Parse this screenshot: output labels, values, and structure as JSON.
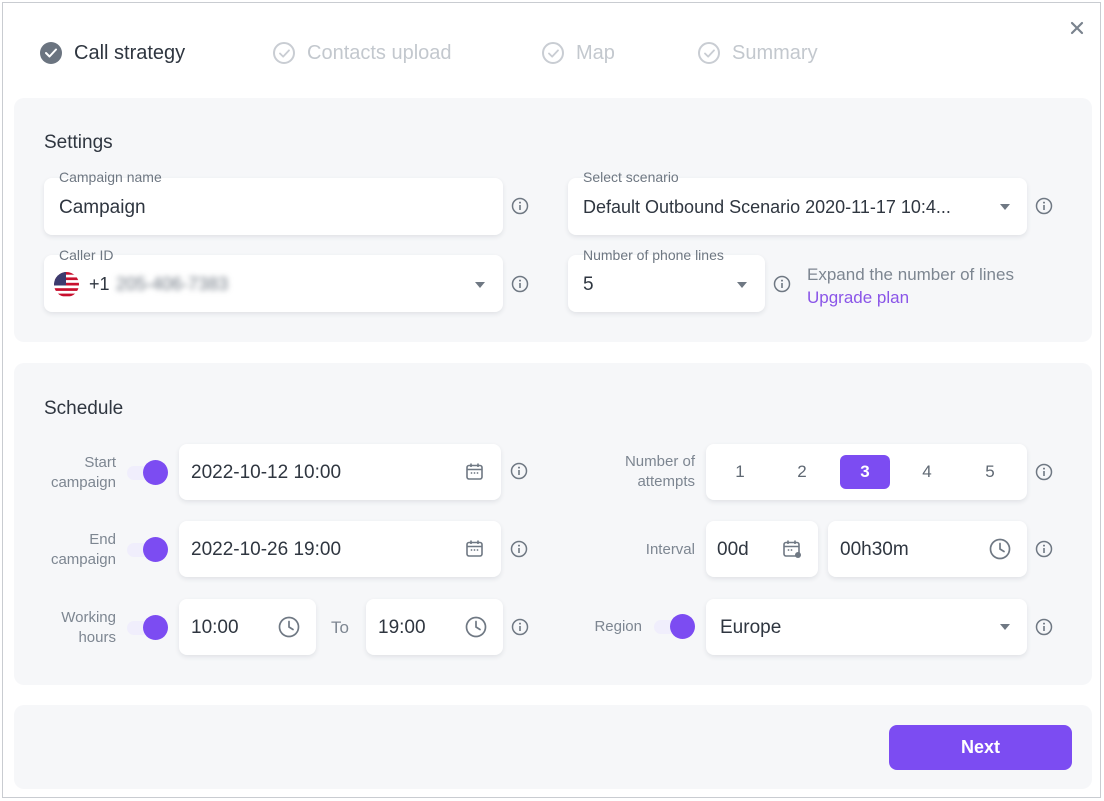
{
  "stepper": {
    "steps": [
      {
        "label": "Call strategy",
        "state": "active"
      },
      {
        "label": "Contacts upload",
        "state": "pending"
      },
      {
        "label": "Map",
        "state": "pending"
      },
      {
        "label": "Summary",
        "state": "pending"
      }
    ],
    "close_icon": "close-icon"
  },
  "settings": {
    "title": "Settings",
    "campaign_name": {
      "label": "Campaign name",
      "value": "Campaign"
    },
    "scenario": {
      "label": "Select scenario",
      "value": "Default Outbound Scenario 2020-11-17 10:4..."
    },
    "caller_id": {
      "label": "Caller ID",
      "prefix": "+1",
      "number": "205-406-7383",
      "flag_icon": "us-flag-icon"
    },
    "phone_lines": {
      "label": "Number of phone lines",
      "value": "5"
    },
    "expand_text": "Expand the number of lines",
    "upgrade_link": "Upgrade plan"
  },
  "schedule": {
    "title": "Schedule",
    "start": {
      "label_line1": "Start",
      "label_line2": "campaign",
      "value": "2022-10-12 10:00",
      "enabled": true
    },
    "end": {
      "label_line1": "End",
      "label_line2": "campaign",
      "value": "2022-10-26 19:00",
      "enabled": true
    },
    "working_hours": {
      "label_line1": "Working",
      "label_line2": "hours",
      "from": "10:00",
      "to_label": "To",
      "to": "19:00",
      "enabled": true
    },
    "attempts": {
      "label_line1": "Number of",
      "label_line2": "attempts",
      "options": [
        "1",
        "2",
        "3",
        "4",
        "5"
      ],
      "selected": "3"
    },
    "interval": {
      "label": "Interval",
      "days": "00d",
      "time": "00h30m"
    },
    "region": {
      "label": "Region",
      "value": "Europe",
      "enabled": true
    }
  },
  "footer": {
    "next_label": "Next"
  },
  "colors": {
    "accent": "#7c4cf2",
    "panel": "#f6f7f9",
    "text": "#2f3640",
    "muted": "#7d8691"
  }
}
